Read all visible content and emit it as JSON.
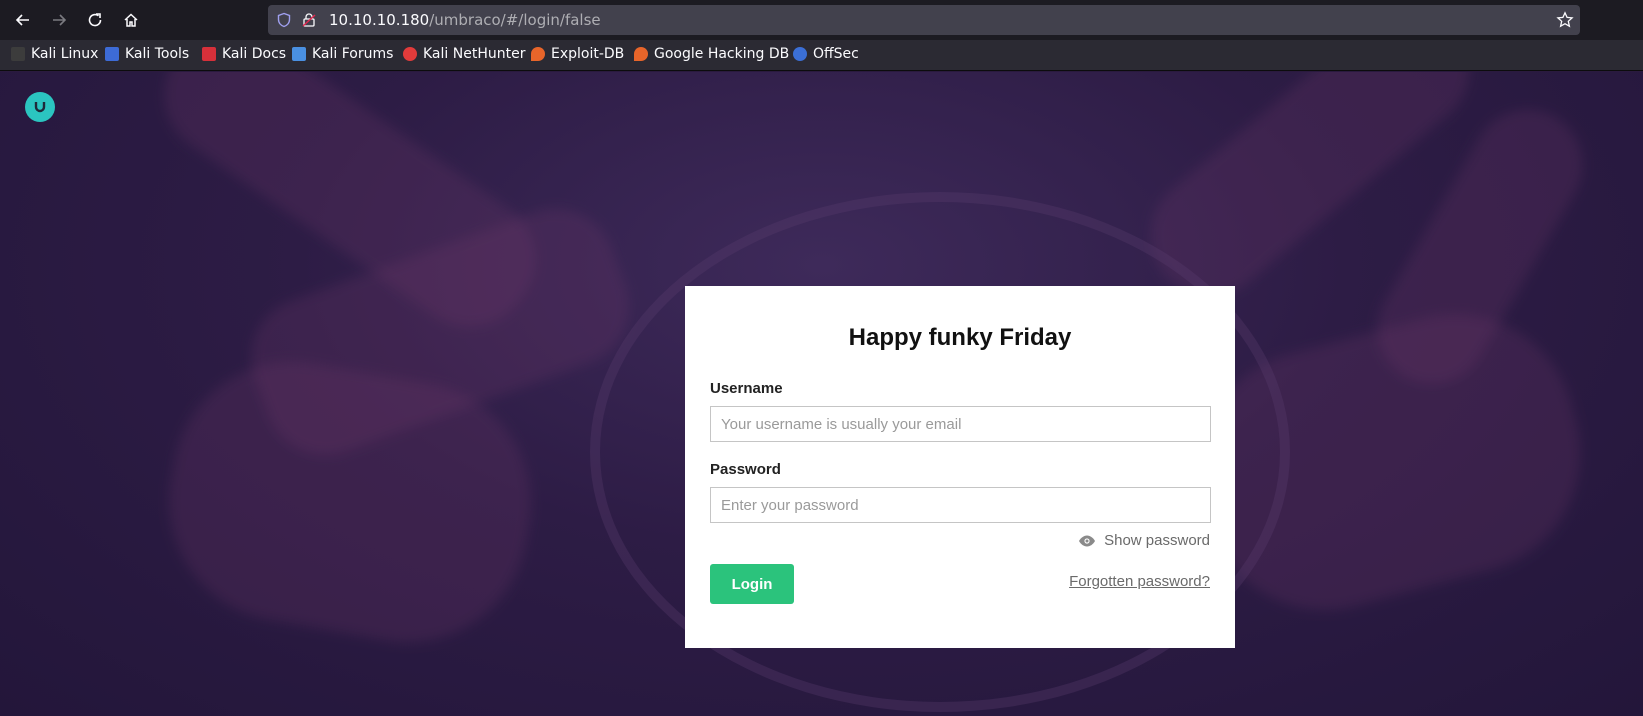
{
  "browser": {
    "url_host": "10.10.10.180",
    "url_path": "/umbraco/#/login/false"
  },
  "bookmarks": [
    {
      "label": "Kali Linux",
      "icon": "kali-dragon-icon",
      "color": "#3c3c3c"
    },
    {
      "label": "Kali Tools",
      "icon": "kali-tools-icon",
      "color": "#3d6bd6"
    },
    {
      "label": "Kali Docs",
      "icon": "kali-docs-icon",
      "color": "#d6303a"
    },
    {
      "label": "Kali Forums",
      "icon": "kali-forums-icon",
      "color": "#4a90e2"
    },
    {
      "label": "Kali NetHunter",
      "icon": "nethunter-icon",
      "color": "#e23b3b"
    },
    {
      "label": "Exploit-DB",
      "icon": "exploit-db-icon",
      "color": "#e8652a"
    },
    {
      "label": "Google Hacking DB",
      "icon": "ghdb-icon",
      "color": "#e8652a"
    },
    {
      "label": "OffSec",
      "icon": "offsec-icon",
      "color": "#3b6fd6"
    }
  ],
  "login": {
    "greeting": "Happy funky Friday",
    "username_label": "Username",
    "username_placeholder": "Your username is usually your email",
    "password_label": "Password",
    "password_placeholder": "Enter your password",
    "show_password": "Show password",
    "login_button": "Login",
    "forgot_link": "Forgotten password?"
  },
  "colors": {
    "accent_green": "#2bc37c",
    "logo_teal": "#2bc5c0",
    "background_purple": "#2d1c45"
  }
}
